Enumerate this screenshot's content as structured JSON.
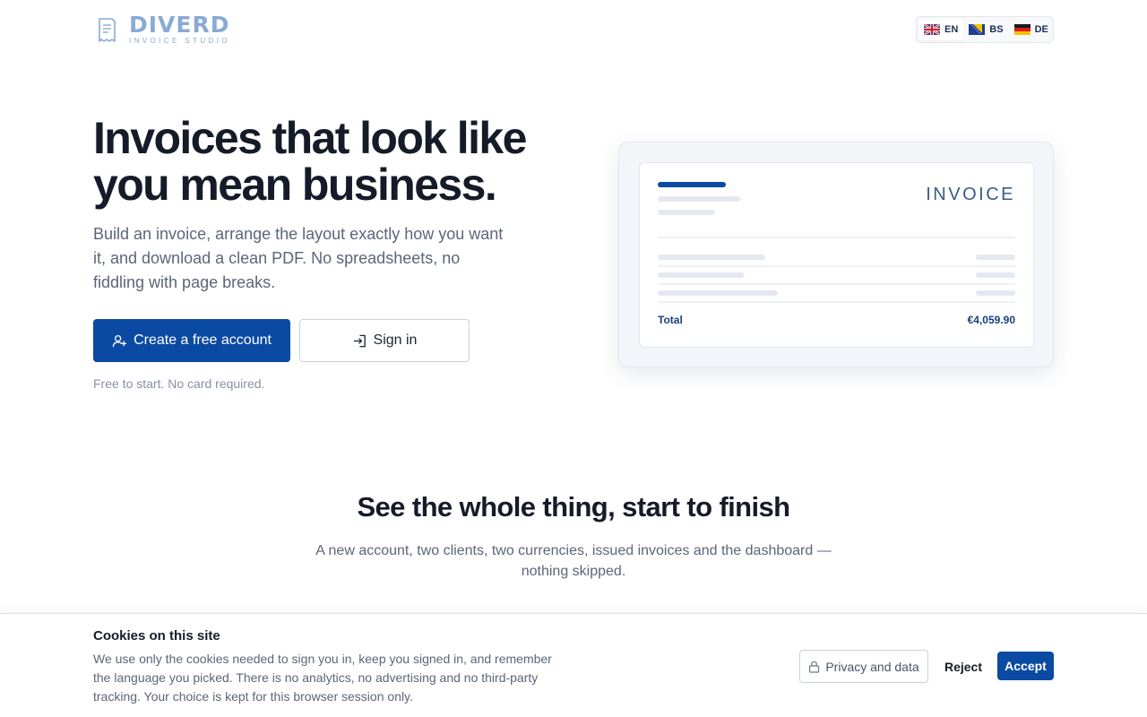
{
  "header": {
    "logo": {
      "word": "DIVERD",
      "tagline": "INVOICE STUDIO"
    },
    "languages": [
      {
        "code": "EN",
        "flag": "uk-flag",
        "active": true
      },
      {
        "code": "BS",
        "flag": "bosnia-flag",
        "active": false
      },
      {
        "code": "DE",
        "flag": "germany-flag",
        "active": false
      }
    ]
  },
  "hero": {
    "title": "Invoices that look like you mean business.",
    "subtitle": "Build an invoice, arrange the layout exactly how you want it, and download a clean PDF. No spreadsheets, no fiddling with page breaks.",
    "primary_cta": "Create a free account",
    "secondary_cta": "Sign in",
    "note": "Free to start. No card required."
  },
  "preview": {
    "heading": "INVOICE",
    "total_label": "Total",
    "total_value": "€4,059.90"
  },
  "section": {
    "title": "See the whole thing, start to finish",
    "subtitle": "A new account, two clients, two currencies, issued invoices and the dashboard — nothing skipped."
  },
  "cookie": {
    "title": "Cookies on this site",
    "text": "We use only the cookies needed to sign you in, keep you signed in, and remember the language you picked. There is no analytics, no advertising and no third-party tracking. Your choice is kept for this browser session only.",
    "privacy_label": "Privacy and data",
    "reject_label": "Reject",
    "accept_label": "Accept"
  },
  "colors": {
    "brand": "#0b4aa2",
    "logo": "#8aaad6",
    "text_dark": "#151b28",
    "text_muted": "#5b6679"
  }
}
